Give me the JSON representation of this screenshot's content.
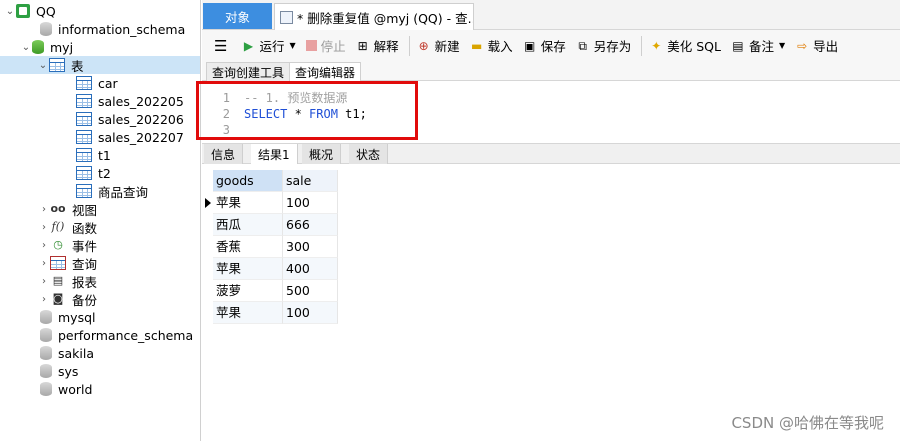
{
  "tree": {
    "connection": "QQ",
    "databases_top": [
      "information_schema"
    ],
    "current_db": "myj",
    "tables_folder": "表",
    "tables": [
      "car",
      "sales_202205",
      "sales_202206",
      "sales_202207",
      "t1",
      "t2",
      "商品查询"
    ],
    "folders": [
      "视图",
      "函数",
      "事件",
      "查询",
      "报表",
      "备份"
    ],
    "databases_bottom": [
      "mysql",
      "performance_schema",
      "sakila",
      "sys",
      "world"
    ]
  },
  "tabs": {
    "objects": "对象",
    "query": "* 删除重复值 @myj (QQ) - 查..."
  },
  "toolbar": {
    "menu": "☰",
    "run": "运行",
    "stop": "停止",
    "explain": "解释",
    "new": "新建",
    "load": "载入",
    "save": "保存",
    "save_as": "另存为",
    "beautify": "美化 SQL",
    "comment": "备注",
    "export": "导出"
  },
  "subtabs": {
    "builder": "查询创建工具",
    "editor": "查询编辑器"
  },
  "editor": {
    "line_numbers": [
      "1",
      "2",
      "3"
    ],
    "line1": "-- 1. 预览数据源",
    "line2_kw1": "SELECT",
    "line2_mid": " * ",
    "line2_kw2": "FROM",
    "line2_end": " t1;",
    "line3": ""
  },
  "result_tabs": {
    "info": "信息",
    "result1": "结果1",
    "overview": "概况",
    "status": "状态"
  },
  "grid": {
    "columns": [
      "goods",
      "sale"
    ],
    "rows": [
      [
        "苹果",
        "100"
      ],
      [
        "西瓜",
        "666"
      ],
      [
        "香蕉",
        "300"
      ],
      [
        "苹果",
        "400"
      ],
      [
        "菠萝",
        "500"
      ],
      [
        "苹果",
        "100"
      ]
    ]
  },
  "watermark": "CSDN @哈佛在等我呢"
}
